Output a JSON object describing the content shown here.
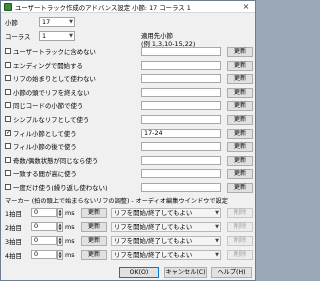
{
  "window": {
    "title": "ユーザートラック作成のアドバンス設定 小節: 17 コーラス 1",
    "close": "×"
  },
  "measure": {
    "label": "小節",
    "value": "17"
  },
  "chorus": {
    "label": "コーラス",
    "value": "1"
  },
  "range_header": {
    "line1": "適用先小節",
    "line2": "(例 1,3,10-15,22)"
  },
  "apply_button": "更新",
  "options": [
    {
      "label": "ユーザートラックに含めない",
      "checked": false,
      "value": ""
    },
    {
      "label": "エンディングで開始する",
      "checked": false,
      "value": ""
    },
    {
      "label": "リフの始まりとして使わない",
      "checked": false,
      "value": ""
    },
    {
      "label": "小節の頭でリフを終えない",
      "checked": false,
      "value": ""
    },
    {
      "label": "同じコードの小節で使う",
      "checked": false,
      "value": ""
    },
    {
      "label": "シンプルなリフとして使う",
      "checked": false,
      "value": ""
    },
    {
      "label": "フィル小節として使う",
      "checked": true,
      "value": "17-24"
    },
    {
      "label": "フィル小節の後で使う",
      "checked": false,
      "value": ""
    },
    {
      "label": "奇数/偶数状態が同じなら使う",
      "checked": false,
      "value": ""
    },
    {
      "label": "一致する間が高に使う",
      "checked": false,
      "value": ""
    },
    {
      "label": "一度だけ使う(繰り返し使わない)",
      "checked": false,
      "value": ""
    }
  ],
  "marker_header": "マーカー (拍の頭上で始まらないリフの調整) - オーディオ編集ウインドウで設定",
  "markers": [
    {
      "label": "1拍目",
      "value": "0",
      "unit": "ms",
      "update": "更新",
      "mode": "リフを開始/終了してもよい",
      "delete": "削除"
    },
    {
      "label": "2拍目",
      "value": "0",
      "unit": "ms",
      "update": "更新",
      "mode": "リフを開始/終了してもよい",
      "delete": "削除"
    },
    {
      "label": "3拍目",
      "value": "0",
      "unit": "ms",
      "update": "更新",
      "mode": "リフを開始/終了してもよい",
      "delete": "削除"
    },
    {
      "label": "4拍目",
      "value": "0",
      "unit": "ms",
      "update": "更新",
      "mode": "リフを開始/終了してもよい",
      "delete": "削除"
    }
  ],
  "footer": {
    "ok": "OK(O)",
    "cancel": "キャンセル(C)",
    "help": "ヘルプ(H)"
  },
  "icons": {
    "app": "app-icon",
    "dropdown": "chevron-down-icon",
    "check": "check-icon"
  },
  "colors": {
    "accent": "#0078d7",
    "app_icon": "#3c8a3c"
  }
}
